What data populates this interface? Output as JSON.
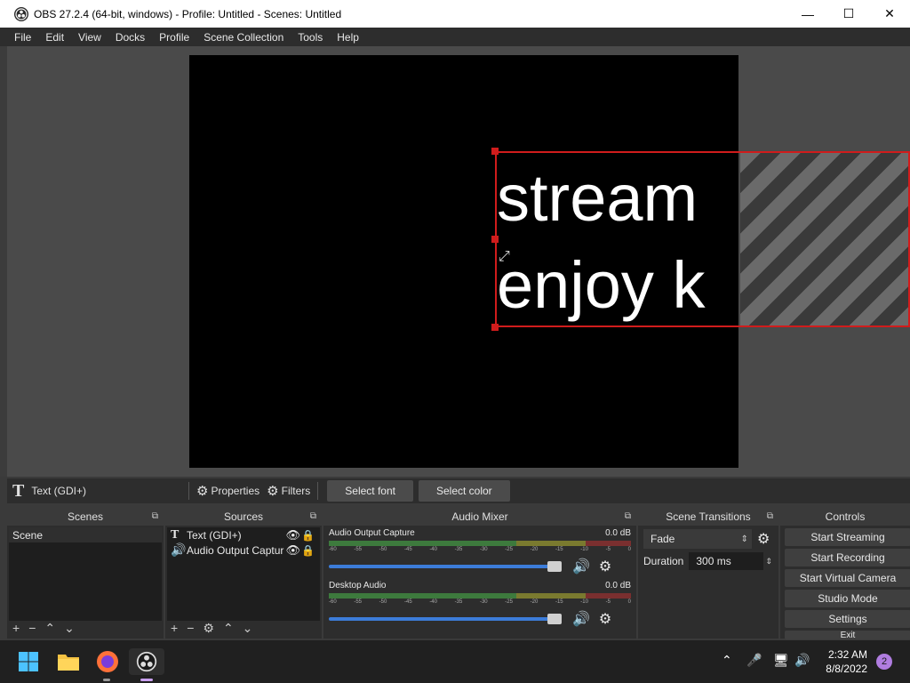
{
  "window": {
    "title": "OBS 27.2.4 (64-bit, windows) - Profile: Untitled - Scenes: Untitled",
    "minimize": "—",
    "maximize": "☐",
    "close": "✕"
  },
  "menu": [
    "File",
    "Edit",
    "View",
    "Docks",
    "Profile",
    "Scene Collection",
    "Tools",
    "Help"
  ],
  "canvas": {
    "line1": "stream",
    "line2": "enjoy k"
  },
  "source_toolbar": {
    "source_name": "Text (GDI+)",
    "properties": "Properties",
    "filters": "Filters",
    "select_font": "Select font",
    "select_color": "Select color"
  },
  "scenes": {
    "title": "Scenes",
    "items": [
      "Scene"
    ]
  },
  "sources": {
    "title": "Sources",
    "items": [
      {
        "name": "Text (GDI+)",
        "icon": "text-icon"
      },
      {
        "name": "Audio Output Captur",
        "icon": "speaker-icon"
      }
    ]
  },
  "mixer": {
    "title": "Audio Mixer",
    "channels": [
      {
        "name": "Audio Output Capture",
        "level": "0.0 dB"
      },
      {
        "name": "Desktop Audio",
        "level": "0.0 dB"
      }
    ],
    "ticks": [
      "-60",
      "-55",
      "-50",
      "-45",
      "-40",
      "-35",
      "-30",
      "-25",
      "-20",
      "-15",
      "-10",
      "-5",
      "0"
    ]
  },
  "transitions": {
    "title": "Scene Transitions",
    "selected": "Fade",
    "duration_label": "Duration",
    "duration_value": "300 ms"
  },
  "controls": {
    "title": "Controls",
    "buttons": [
      "Start Streaming",
      "Start Recording",
      "Start Virtual Camera",
      "Studio Mode",
      "Settings",
      "Exit"
    ]
  },
  "taskbar": {
    "time": "2:32 AM",
    "date": "8/8/2022",
    "notifications": "2"
  },
  "colors": {
    "selection_red": "#d01c1c",
    "fader_blue": "#3c7cd9"
  }
}
